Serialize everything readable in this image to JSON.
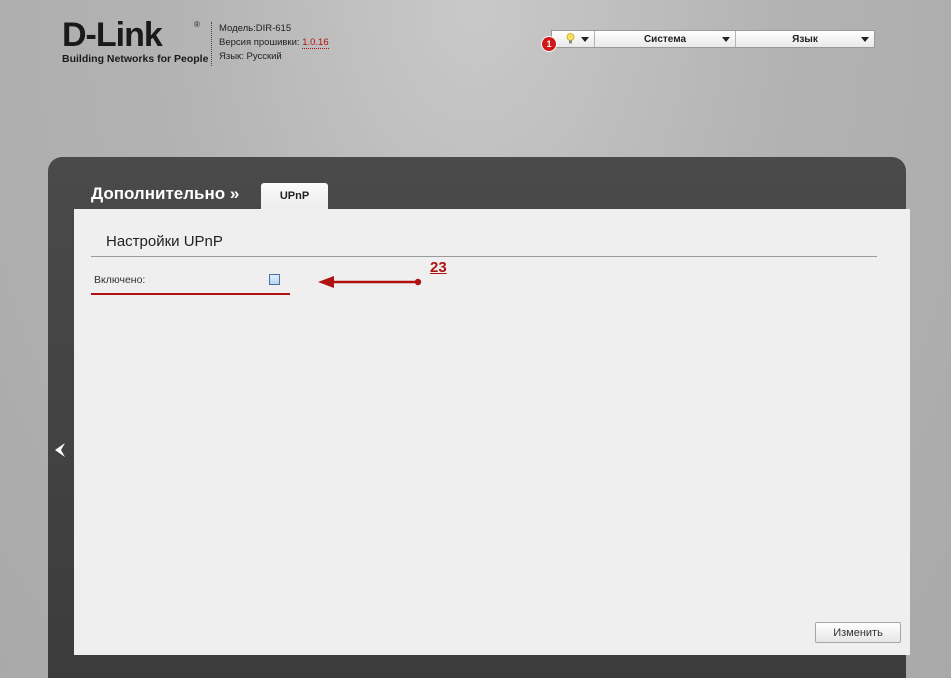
{
  "brand": {
    "logo_text": "D-Link",
    "logo_registered": "®",
    "tagline": "Building Networks for People"
  },
  "device": {
    "model_label": "Модель:",
    "model_value": "DIR-615",
    "firmware_label": "Версия прошивки:",
    "firmware_value": "1.0.16",
    "language_label": "Язык:",
    "language_value": "Русский"
  },
  "top_menu": {
    "notifications_count": "1",
    "notifications_icon": "lightbulb-icon",
    "items": [
      {
        "label": "Система"
      },
      {
        "label": "Язык"
      }
    ]
  },
  "nav": {
    "breadcrumb": "Дополнительно »",
    "active_tab": "UPnP",
    "back_icon": "chevron-left-icon"
  },
  "section": {
    "title": "Настройки UPnP",
    "fields": [
      {
        "label": "Включено:",
        "type": "checkbox",
        "checked": false
      }
    ]
  },
  "annotation": {
    "number": "23",
    "color": "#b01010"
  },
  "actions": {
    "submit_label": "Изменить"
  },
  "colors": {
    "frame": "#424242",
    "panel": "#efefef",
    "accent_red": "#b01010"
  }
}
